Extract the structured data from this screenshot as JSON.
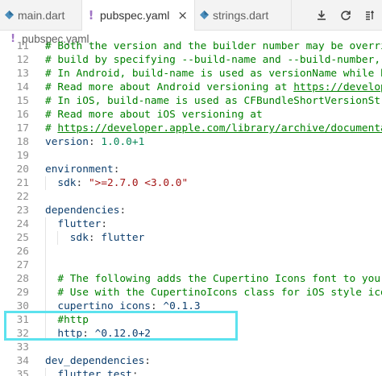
{
  "tabs": [
    {
      "label": "main.dart",
      "icon": "dart-icon",
      "active": false
    },
    {
      "label": "pubspec.yaml",
      "icon": "yaml-icon",
      "active": true,
      "close": "×"
    },
    {
      "label": "strings.dart",
      "icon": "dart-icon",
      "active": false
    }
  ],
  "toolbar": {
    "icons": [
      "download-icon",
      "refresh-icon",
      "open-changes-icon"
    ]
  },
  "breadcrumb": {
    "file": "pubspec.yaml"
  },
  "lines": [
    {
      "n": "11",
      "parts": [
        {
          "t": "# Both the version and the builder number may be overridden in",
          "c": "cm"
        }
      ]
    },
    {
      "n": "12",
      "parts": [
        {
          "t": "# build by specifying --build-name and --build-number, respect",
          "c": "cm"
        }
      ]
    },
    {
      "n": "13",
      "parts": [
        {
          "t": "# In Android, build-name is used as versionName while build-nu",
          "c": "cm"
        }
      ]
    },
    {
      "n": "14",
      "parts": [
        {
          "t": "# Read more about Android versioning at ",
          "c": "cm"
        },
        {
          "t": "https://developer.and",
          "c": "link"
        }
      ]
    },
    {
      "n": "15",
      "parts": [
        {
          "t": "# In iOS, build-name is used as CFBundleShortVersionString whi",
          "c": "cm"
        }
      ]
    },
    {
      "n": "16",
      "parts": [
        {
          "t": "# Read more about iOS versioning at",
          "c": "cm"
        }
      ]
    },
    {
      "n": "17",
      "parts": [
        {
          "t": "# ",
          "c": "cm"
        },
        {
          "t": "https://developer.apple.com/library/archive/documentation/Ge",
          "c": "link"
        }
      ]
    },
    {
      "n": "18",
      "parts": [
        {
          "t": "version",
          "c": "key"
        },
        {
          "t": ": ",
          "c": "plain"
        },
        {
          "t": "1.0.0+1",
          "c": "num"
        }
      ]
    },
    {
      "n": "19",
      "parts": []
    },
    {
      "n": "20",
      "parts": [
        {
          "t": "environment",
          "c": "key"
        },
        {
          "t": ":",
          "c": "plain"
        }
      ]
    },
    {
      "n": "21",
      "indent": 1,
      "parts": [
        {
          "t": "sdk",
          "c": "key"
        },
        {
          "t": ": ",
          "c": "plain"
        },
        {
          "t": "\">=2.7.0 <3.0.0\"",
          "c": "str"
        }
      ]
    },
    {
      "n": "22",
      "parts": []
    },
    {
      "n": "23",
      "parts": [
        {
          "t": "dependencies",
          "c": "key"
        },
        {
          "t": ":",
          "c": "plain"
        }
      ]
    },
    {
      "n": "24",
      "indent": 1,
      "parts": [
        {
          "t": "flutter",
          "c": "key"
        },
        {
          "t": ":",
          "c": "plain"
        }
      ]
    },
    {
      "n": "25",
      "indent": 2,
      "parts": [
        {
          "t": "sdk",
          "c": "key"
        },
        {
          "t": ": ",
          "c": "plain"
        },
        {
          "t": "flutter",
          "c": "key"
        }
      ]
    },
    {
      "n": "26",
      "indent": 1,
      "parts": []
    },
    {
      "n": "27",
      "indent": 1,
      "parts": []
    },
    {
      "n": "28",
      "indent": 1,
      "parts": [
        {
          "t": "# The following adds the Cupertino Icons font to your applic",
          "c": "cm"
        }
      ]
    },
    {
      "n": "29",
      "indent": 1,
      "parts": [
        {
          "t": "# Use with the CupertinoIcons class for iOS style icons.",
          "c": "cm"
        }
      ]
    },
    {
      "n": "30",
      "indent": 1,
      "parts": [
        {
          "t": "cupertino_icons",
          "c": "key"
        },
        {
          "t": ": ",
          "c": "plain"
        },
        {
          "t": "^0.1.3",
          "c": "key"
        }
      ]
    },
    {
      "n": "31",
      "indent": 1,
      "parts": [
        {
          "t": "#http",
          "c": "cm"
        }
      ]
    },
    {
      "n": "32",
      "indent": 1,
      "parts": [
        {
          "t": "http",
          "c": "key"
        },
        {
          "t": ": ",
          "c": "plain"
        },
        {
          "t": "^0.12.0+2",
          "c": "key"
        }
      ]
    },
    {
      "n": "33",
      "parts": []
    },
    {
      "n": "34",
      "parts": [
        {
          "t": "dev_dependencies",
          "c": "key"
        },
        {
          "t": ":",
          "c": "plain"
        }
      ]
    },
    {
      "n": "35",
      "indent": 1,
      "parts": [
        {
          "t": "flutter_test",
          "c": "key"
        },
        {
          "t": ":",
          "c": "plain"
        }
      ]
    }
  ],
  "colors": {
    "highlight": "#5ce2ee",
    "comment": "#008000",
    "key": "#0e3f6e",
    "number": "#098658",
    "string": "#a31515"
  }
}
